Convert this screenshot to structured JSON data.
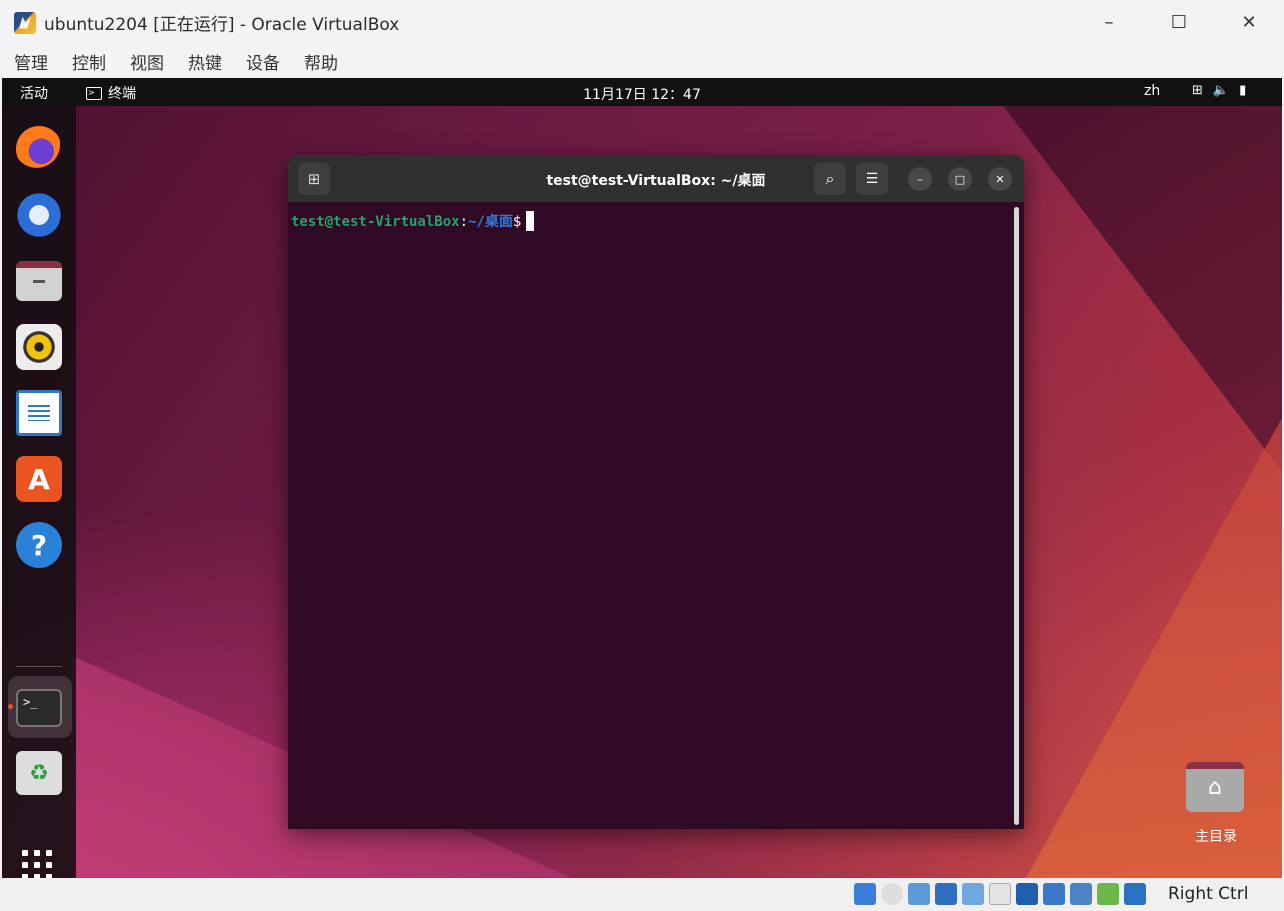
{
  "host": {
    "title": "ubuntu2204 [正在运行] - Oracle VirtualBox",
    "menu": [
      "管理",
      "控制",
      "视图",
      "热键",
      "设备",
      "帮助"
    ],
    "window_buttons": {
      "minimize": "–",
      "maximize": "☐",
      "close": "✕"
    },
    "statusbar": {
      "host_key": "Right Ctrl"
    }
  },
  "guest": {
    "topbar": {
      "activities": "活动",
      "app_name": "终端",
      "clock": "11月17日  12：47",
      "language": "zh",
      "status_icons": [
        "network-icon",
        "volume-icon",
        "battery-icon"
      ]
    },
    "dock": {
      "items": [
        "firefox",
        "thunderbird",
        "files",
        "rhythmbox",
        "libreoffice-writer",
        "app-center",
        "help",
        "terminal",
        "trash"
      ],
      "help_glyph": "?",
      "appcenter_glyph": "A",
      "terminal_glyph": ">_",
      "trash_glyph": "♻"
    },
    "terminal": {
      "title": "test@test-VirtualBox: ~/桌面",
      "prompt_user": "test@test-VirtualBox",
      "prompt_colon": ":",
      "prompt_path": "~/桌面",
      "prompt_symbol": "$"
    },
    "desktop": {
      "home_label": "主目录"
    }
  },
  "colors": {
    "terminal_bg": "#300a24",
    "prompt_user": "#26a269",
    "prompt_path": "#2a7bde",
    "accent": "#e95420"
  }
}
